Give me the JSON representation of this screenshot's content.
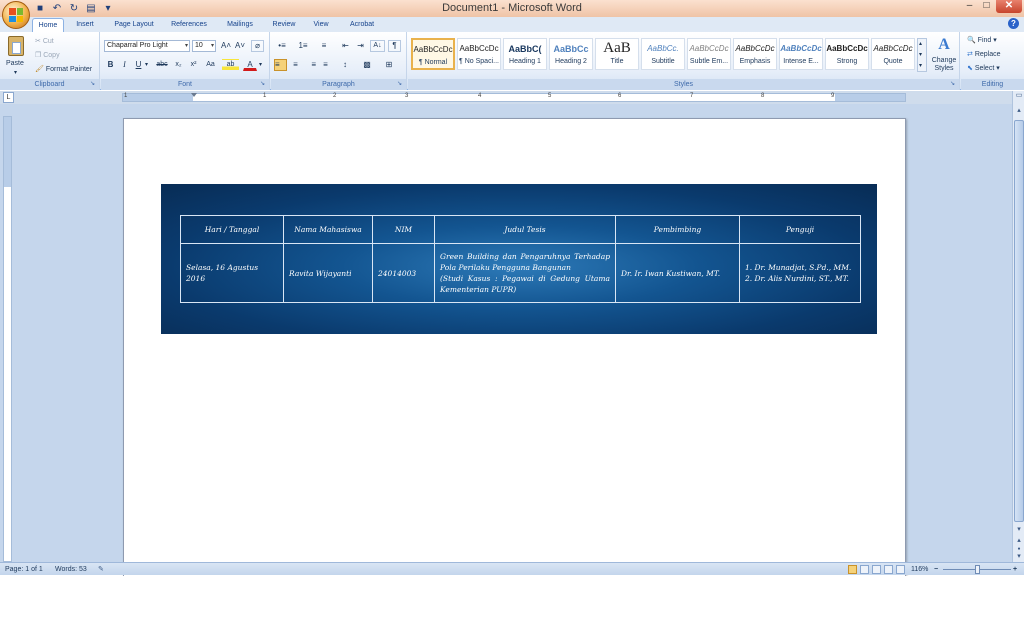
{
  "window": {
    "title": "Document1 - Microsoft Word",
    "min_glyph": "–",
    "max_glyph": "□",
    "close_glyph": "✕"
  },
  "quick_access": {
    "save_glyph": "■",
    "undo_glyph": "↶",
    "redo_glyph": "↻",
    "print_glyph": "▤",
    "more_glyph": "▾"
  },
  "tabs": [
    "Home",
    "Insert",
    "Page Layout",
    "References",
    "Mailings",
    "Review",
    "View",
    "Acrobat"
  ],
  "active_tab": "Home",
  "help_glyph": "?",
  "clipboard": {
    "paste": "Paste",
    "cut": "Cut",
    "copy": "Copy",
    "format_painter": "Format Painter",
    "label": "Clipboard"
  },
  "font": {
    "name": "Chaparral Pro Light",
    "size": "10",
    "grow": "A˄",
    "shrink": "A˅",
    "clear": "⌀",
    "bold": "B",
    "italic": "I",
    "underline": "U",
    "strike": "abc",
    "subscript": "x₂",
    "superscript": "x²",
    "change_case": "Aa",
    "highlight": "ab",
    "font_color": "A",
    "label": "Font"
  },
  "paragraph": {
    "label": "Paragraph",
    "bullets": "•≡",
    "numbering": "1≡",
    "multilevel": "≡",
    "decrease_indent": "⇤",
    "increase_indent": "⇥",
    "sort": "A↓",
    "show_marks": "¶",
    "align_left": "≡",
    "align_center": "≡",
    "align_right": "≡",
    "justify": "≡",
    "line_spacing": "↕",
    "shading": "▩",
    "borders": "⊞"
  },
  "styles": {
    "label": "Styles",
    "items": [
      {
        "sample": "AaBbCcDc",
        "name": "¶ Normal"
      },
      {
        "sample": "AaBbCcDc",
        "name": "¶ No Spaci..."
      },
      {
        "sample": "AaBbC(",
        "name": "Heading 1"
      },
      {
        "sample": "AaBbCc",
        "name": "Heading 2"
      },
      {
        "sample": "AaB",
        "name": "Title"
      },
      {
        "sample": "AaBbCc.",
        "name": "Subtitle"
      },
      {
        "sample": "AaBbCcDc",
        "name": "Subtle Em..."
      },
      {
        "sample": "AaBbCcDc",
        "name": "Emphasis"
      },
      {
        "sample": "AaBbCcDc",
        "name": "Intense E..."
      },
      {
        "sample": "AaBbCcDc",
        "name": "Strong"
      },
      {
        "sample": "AaBbCcDc",
        "name": "Quote"
      }
    ],
    "change_styles": "Change Styles",
    "change_styles_icon": "A"
  },
  "editing": {
    "label": "Editing",
    "find": "Find",
    "replace": "Replace",
    "select": "Select"
  },
  "ruler": {
    "tab_glyph": "L",
    "numbers": [
      "1",
      "1",
      "2",
      "3",
      "4",
      "5",
      "6",
      "7",
      "8",
      "9"
    ]
  },
  "table": {
    "headers": [
      "Hari / Tanggal",
      "Nama Mahasiswa",
      "NIM",
      "Judul Tesis",
      "Pembimbing",
      "Penguji"
    ],
    "row": {
      "tanggal": "Selasa, 16 Agustus 2016",
      "nama": "Ravita  Wijayanti",
      "nim": "24014003",
      "judul": [
        "Green Building dan Pengaruhnya Terhadap",
        "Pola Perilaku Pengguna Bangunan",
        "(Studi Kasus : Pegawai di Gedung Utama",
        "Kementerian PUPR)"
      ],
      "pembimbing": "Dr. Ir. Iwan Kustiwan, MT.",
      "penguji": [
        "1. Dr. Munadjat, S.Pd., MM.",
        "2. Dr. Alis Nurdini, ST., MT."
      ]
    }
  },
  "statusbar": {
    "page": "Page: 1 of 1",
    "words": "Words: 53",
    "zoom": "116%",
    "zoom_minus": "−",
    "zoom_plus": "+"
  },
  "scrollbar": {
    "up": "▴",
    "down": "▾",
    "prev": "▴",
    "browse": "●",
    "next": "▾"
  }
}
